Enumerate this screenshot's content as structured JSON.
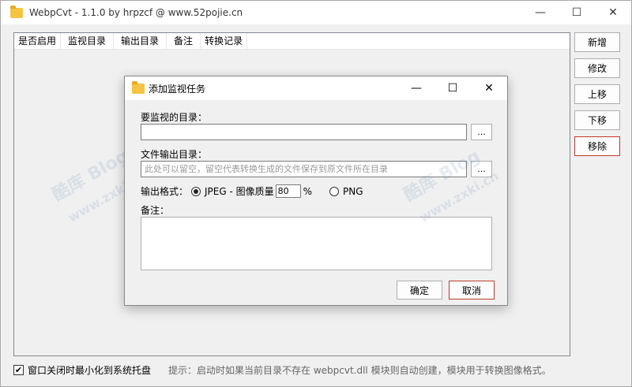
{
  "window": {
    "title": "WebpCvt - 1.1.0 by hrpzcf @ www.52pojie.cn",
    "controls": [
      "—",
      "☐",
      "✕"
    ]
  },
  "table": {
    "columns": [
      "是否启用",
      "监视目录",
      "输出目录",
      "备注",
      "转换记录"
    ]
  },
  "side_buttons": {
    "add": "新增",
    "edit": "修改",
    "move_up": "上移",
    "move_down": "下移",
    "remove": "移除"
  },
  "bottom": {
    "minimize_checkbox_checked": true,
    "minimize_label": "窗口关闭时最小化到系统托盘",
    "hint": "提示：启动时如果当前目录不存在 webpcvt.dll 模块则自动创建，模块用于转换图像格式。"
  },
  "dialog": {
    "title": "添加监视任务",
    "controls": [
      "—",
      "☐",
      "✕"
    ],
    "watch_dir_label": "要监视的目录：",
    "watch_dir_value": "",
    "browse_label": "...",
    "output_dir_label": "文件输出目录：",
    "output_dir_placeholder": "此处可以留空，留空代表转换生成的文件保存到原文件所在目录",
    "format_label": "输出格式：",
    "jpeg_label": "JPEG - 图像质量",
    "jpeg_selected": true,
    "quality_value": "80",
    "percent": "%",
    "png_label": "PNG",
    "note_label": "备注：",
    "ok_label": "确定",
    "cancel_label": "取消"
  },
  "watermark": {
    "text1": "酷库 Blog",
    "text2": "www.zxki.cn"
  }
}
